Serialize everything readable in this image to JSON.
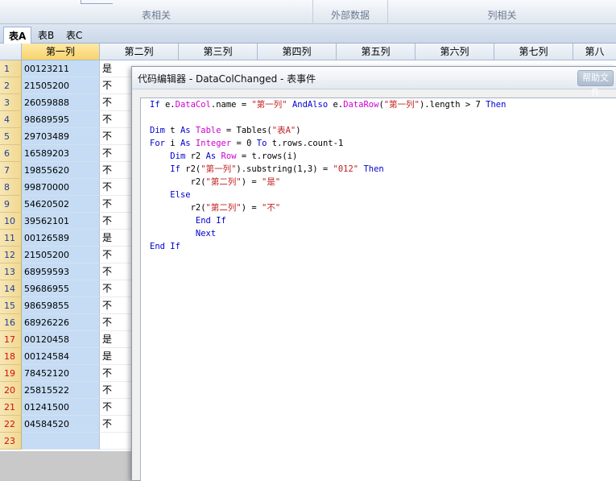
{
  "ribbon": {
    "groups": [
      "表相关",
      "外部数据",
      "列相关"
    ]
  },
  "sheet_tabs": [
    {
      "label": "表A",
      "active": true
    },
    {
      "label": "表B",
      "active": false
    },
    {
      "label": "表C",
      "active": false
    }
  ],
  "columns": [
    "第一列",
    "第二列",
    "第三列",
    "第四列",
    "第五列",
    "第六列",
    "第七列",
    "第八"
  ],
  "rows": [
    {
      "num": "1",
      "c1": "00123211",
      "c2": "是"
    },
    {
      "num": "2",
      "c1": "21505200",
      "c2": "不"
    },
    {
      "num": "3",
      "c1": "26059888",
      "c2": "不"
    },
    {
      "num": "4",
      "c1": "98689595",
      "c2": "不"
    },
    {
      "num": "5",
      "c1": "29703489",
      "c2": "不"
    },
    {
      "num": "6",
      "c1": "16589203",
      "c2": "不"
    },
    {
      "num": "7",
      "c1": "19855620",
      "c2": "不"
    },
    {
      "num": "8",
      "c1": "99870000",
      "c2": "不"
    },
    {
      "num": "9",
      "c1": "54620502",
      "c2": "不"
    },
    {
      "num": "10",
      "c1": "39562101",
      "c2": "不"
    },
    {
      "num": "11",
      "c1": "00126589",
      "c2": "是"
    },
    {
      "num": "12",
      "c1": "21505200",
      "c2": "不"
    },
    {
      "num": "13",
      "c1": "68959593",
      "c2": "不"
    },
    {
      "num": "14",
      "c1": "59686955",
      "c2": "不"
    },
    {
      "num": "15",
      "c1": "98659855",
      "c2": "不"
    },
    {
      "num": "16",
      "c1": "68926226",
      "c2": "不"
    },
    {
      "num": "17",
      "c1": "00120458",
      "c2": "是"
    },
    {
      "num": "18",
      "c1": "00124584",
      "c2": "是"
    },
    {
      "num": "19",
      "c1": "78452120",
      "c2": "不"
    },
    {
      "num": "20",
      "c1": "25815522",
      "c2": "不"
    },
    {
      "num": "21",
      "c1": "01241500",
      "c2": "不"
    },
    {
      "num": "22",
      "c1": "04584520",
      "c2": "不"
    },
    {
      "num": "23",
      "c1": "",
      "c2": ""
    }
  ],
  "editor": {
    "title": "代码编辑器 - DataColChanged - 表事件",
    "title_button": "帮助文件",
    "code_lines": [
      "If e.DataCol.name = \"第一列\" AndAlso e.DataRow(\"第一列\").length > 7 Then",
      "",
      "Dim t As Table = Tables(\"表A\")",
      "For i As Integer = 0 To t.rows.count-1",
      "    Dim r2 As Row = t.rows(i)",
      "    If r2(\"第一列\").substring(1,3) = \"012\" Then",
      "        r2(\"第二列\") = \"是\"",
      "    Else",
      "        r2(\"第二列\") = \"不\"",
      "         End If",
      "         Next",
      "End If"
    ]
  },
  "colors": {
    "selected_col": "#c5dcf4",
    "row_num_red": "#d01010",
    "keyword": "#0000d0",
    "type": "#d000d0",
    "string": "#c02020"
  }
}
